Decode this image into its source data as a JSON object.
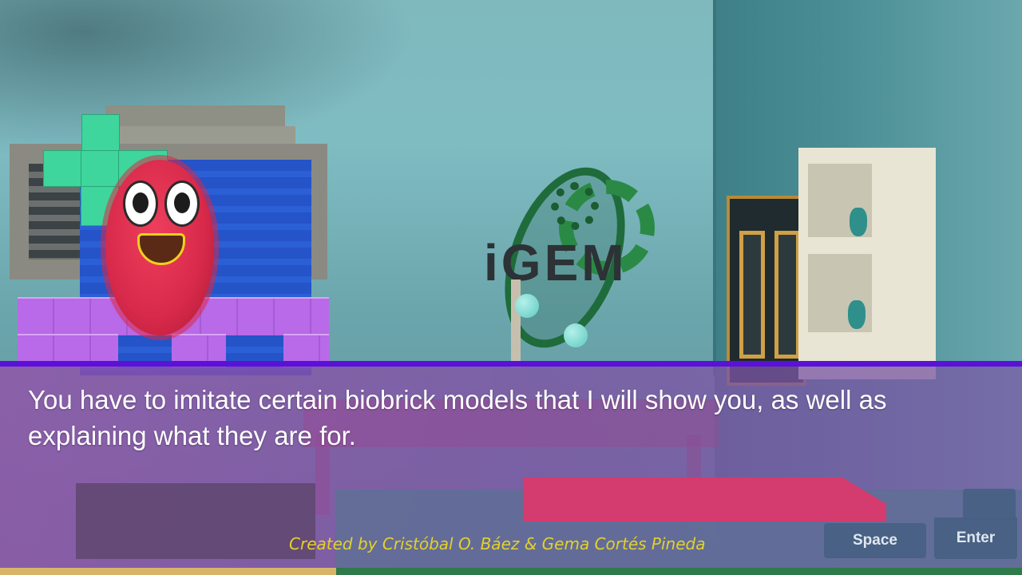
{
  "dialog": {
    "text": "You have to imitate certain biobrick models that I will show you, as well as explaining what they are for."
  },
  "credits": {
    "text": "Created by Cristóbal O. Báez & Gema Cortés Pineda"
  },
  "keys": {
    "space_label": "Space",
    "enter_label": "Enter"
  },
  "logo": {
    "text": "iGEM"
  },
  "colors": {
    "dialog_border": "#5a12d8",
    "credits_text": "#e3d12a",
    "bacterium": "#d7294a",
    "logo_green": "#2a8a45"
  }
}
